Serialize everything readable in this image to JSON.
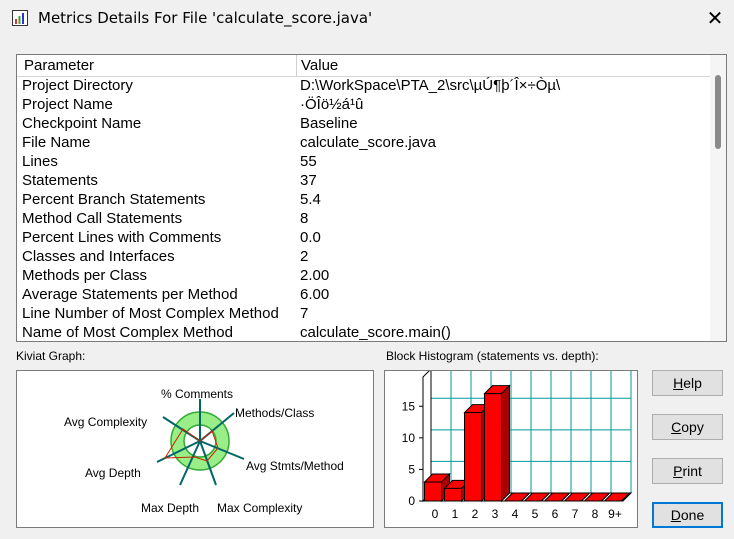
{
  "window": {
    "title": "Metrics Details For File 'calculate_score.java'"
  },
  "table": {
    "headers": [
      "Parameter",
      "Value"
    ],
    "rows": [
      [
        "Project Directory",
        "D:\\WorkSpace\\PTA_2\\src\\µÚ¶þ´Î×÷Òµ\\"
      ],
      [
        "Project Name",
        "·ÖÎö½á¹û"
      ],
      [
        "Checkpoint Name",
        "Baseline"
      ],
      [
        "File Name",
        "calculate_score.java"
      ],
      [
        "Lines",
        "55"
      ],
      [
        "Statements",
        "37"
      ],
      [
        "Percent Branch Statements",
        "5.4"
      ],
      [
        "Method Call Statements",
        "8"
      ],
      [
        "Percent Lines with Comments",
        "0.0"
      ],
      [
        "Classes and Interfaces",
        "2"
      ],
      [
        "Methods per Class",
        "2.00"
      ],
      [
        "Average Statements per Method",
        "6.00"
      ],
      [
        "Line Number of Most Complex Method",
        "7"
      ],
      [
        "Name of Most Complex Method",
        "calculate_score.main()"
      ]
    ]
  },
  "kiviat": {
    "label": "Kiviat Graph:",
    "axes": [
      "% Comments",
      "Methods/Class",
      "Avg Stmts/Method",
      "Max Complexity",
      "Max Depth",
      "Avg Depth",
      "Avg Complexity"
    ]
  },
  "histogram": {
    "label": "Block Histogram (statements vs. depth):"
  },
  "chart_data": {
    "type": "bar",
    "categories": [
      "0",
      "1",
      "2",
      "3",
      "4",
      "5",
      "6",
      "7",
      "8",
      "9+"
    ],
    "values": [
      3,
      2,
      14,
      17,
      0,
      0,
      0,
      0,
      0,
      0
    ],
    "y_ticks": [
      "0",
      "5",
      "10",
      "15"
    ],
    "ylim": [
      0,
      19
    ],
    "grid": true,
    "bar_color": "#ff0000"
  },
  "buttons": {
    "help": {
      "pre": "",
      "u": "H",
      "post": "elp"
    },
    "copy": {
      "pre": "",
      "u": "C",
      "post": "opy"
    },
    "print": {
      "pre": "",
      "u": "P",
      "post": "rint"
    },
    "done": {
      "pre": "",
      "u": "D",
      "post": "one"
    }
  },
  "colors": {
    "kiviat_fill": "#99ee88",
    "kiviat_ring": "#33aa33",
    "bar": "#ff0000",
    "bar_dark": "#aa0000",
    "grid": "#009999",
    "focus": "#0078d7"
  }
}
